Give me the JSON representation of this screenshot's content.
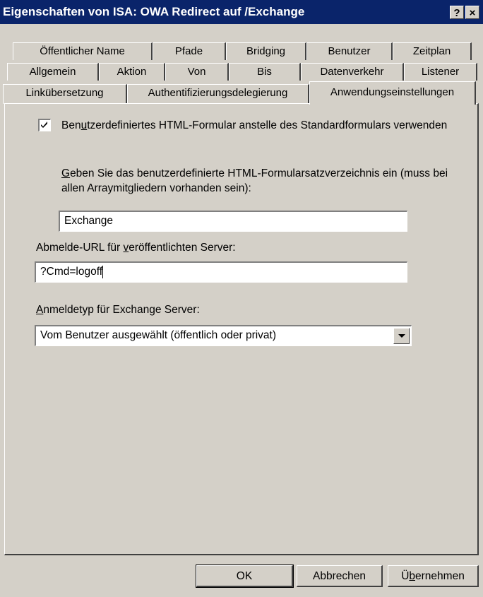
{
  "window": {
    "title": "Eigenschaften von ISA: OWA Redirect auf /Exchange",
    "help_label": "?",
    "close_label": "×"
  },
  "tabs": {
    "row1": [
      "Öffentlicher Name",
      "Pfade",
      "Bridging",
      "Benutzer",
      "Zeitplan"
    ],
    "row2": [
      "Allgemein",
      "Aktion",
      "Von",
      "Bis",
      "Datenverkehr",
      "Listener"
    ],
    "row3": [
      "Linkübersetzung",
      "Authentifizierungsdelegierung",
      "Anwendungseinstellungen"
    ],
    "active": "Anwendungseinstellungen"
  },
  "form": {
    "custom_form_checkbox": {
      "checked": true,
      "label_pre": "Ben",
      "label_u": "u",
      "label_post": "tzerdefiniertes HTML-Formular anstelle des Standardformulars verwenden"
    },
    "form_dir_label_u": "G",
    "form_dir_label_post": "eben Sie das benutzerdefinierte HTML-Formularsatzverzeichnis ein (muss bei allen Arraymitgliedern vorhanden sein):",
    "form_dir_value": "Exchange",
    "logoff_label_pre": "Abmelde-URL für ",
    "logoff_label_u": "v",
    "logoff_label_post": "eröffentlichten Server:",
    "logoff_value": "?Cmd=logoff",
    "logon_type_label_u": "A",
    "logon_type_label_post": "nmeldetyp für Exchange Server:",
    "logon_type_value": "Vom Benutzer ausgewählt (öffentlich oder privat)"
  },
  "buttons": {
    "ok": "OK",
    "cancel": "Abbrechen",
    "apply_pre": "Ü",
    "apply_u": "b",
    "apply_post": "ernehmen"
  }
}
